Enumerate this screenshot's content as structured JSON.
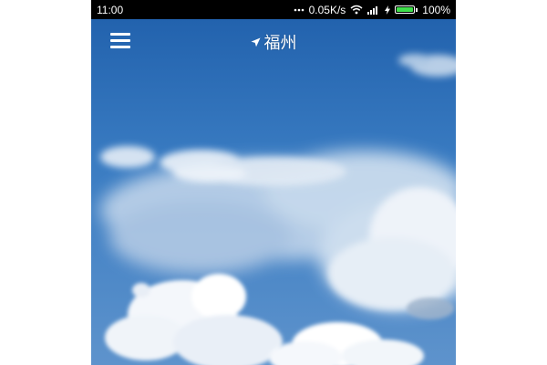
{
  "status_bar": {
    "time": "11:00",
    "network_speed": "0.05K/s",
    "battery_level": "100%",
    "battery_fraction": 1.0,
    "icons": [
      "more-dots-icon",
      "wifi-icon",
      "signal-icon",
      "charging-bolt-icon",
      "battery-icon"
    ],
    "battery_color": "#3ee04a"
  },
  "app_bar": {
    "menu_icon": "hamburger-menu-icon",
    "location_icon": "location-arrow-icon",
    "city": "福州"
  },
  "background": {
    "sky_color": "#2b6fb8",
    "cloud_color": "#ffffff"
  }
}
